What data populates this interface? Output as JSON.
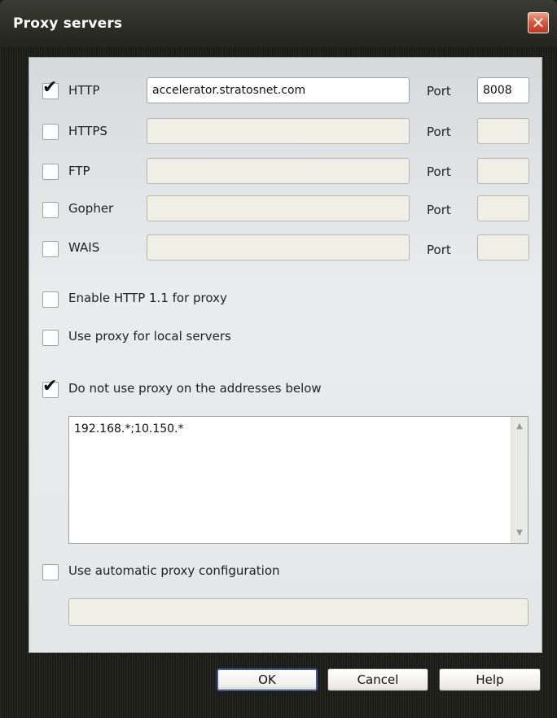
{
  "window": {
    "title": "Proxy servers",
    "close_glyph": "✕"
  },
  "proxies": [
    {
      "protocol": "HTTP",
      "checked": true,
      "address": "accelerator.stratosnet.com",
      "port_label": "Port",
      "port": "8008"
    },
    {
      "protocol": "HTTPS",
      "checked": false,
      "address": "",
      "port_label": "Port",
      "port": ""
    },
    {
      "protocol": "FTP",
      "checked": false,
      "address": "",
      "port_label": "Port",
      "port": ""
    },
    {
      "protocol": "Gopher",
      "checked": false,
      "address": "",
      "port_label": "Port",
      "port": ""
    },
    {
      "protocol": "WAIS",
      "checked": false,
      "address": "",
      "port_label": "Port",
      "port": ""
    }
  ],
  "options": {
    "enable_http11": {
      "label": "Enable HTTP 1.1 for proxy",
      "checked": false
    },
    "local_servers": {
      "label": "Use proxy for local servers",
      "checked": false
    },
    "no_proxy": {
      "label": "Do not use proxy on the addresses below",
      "checked": true,
      "value": "192.168.*;10.150.*"
    },
    "auto_config": {
      "label": "Use automatic proxy configuration",
      "checked": false,
      "value": ""
    }
  },
  "buttons": {
    "ok": "OK",
    "cancel": "Cancel",
    "help": "Help"
  },
  "check_glyph": "✔",
  "scroll_up_glyph": "▲",
  "scroll_down_glyph": "▼"
}
